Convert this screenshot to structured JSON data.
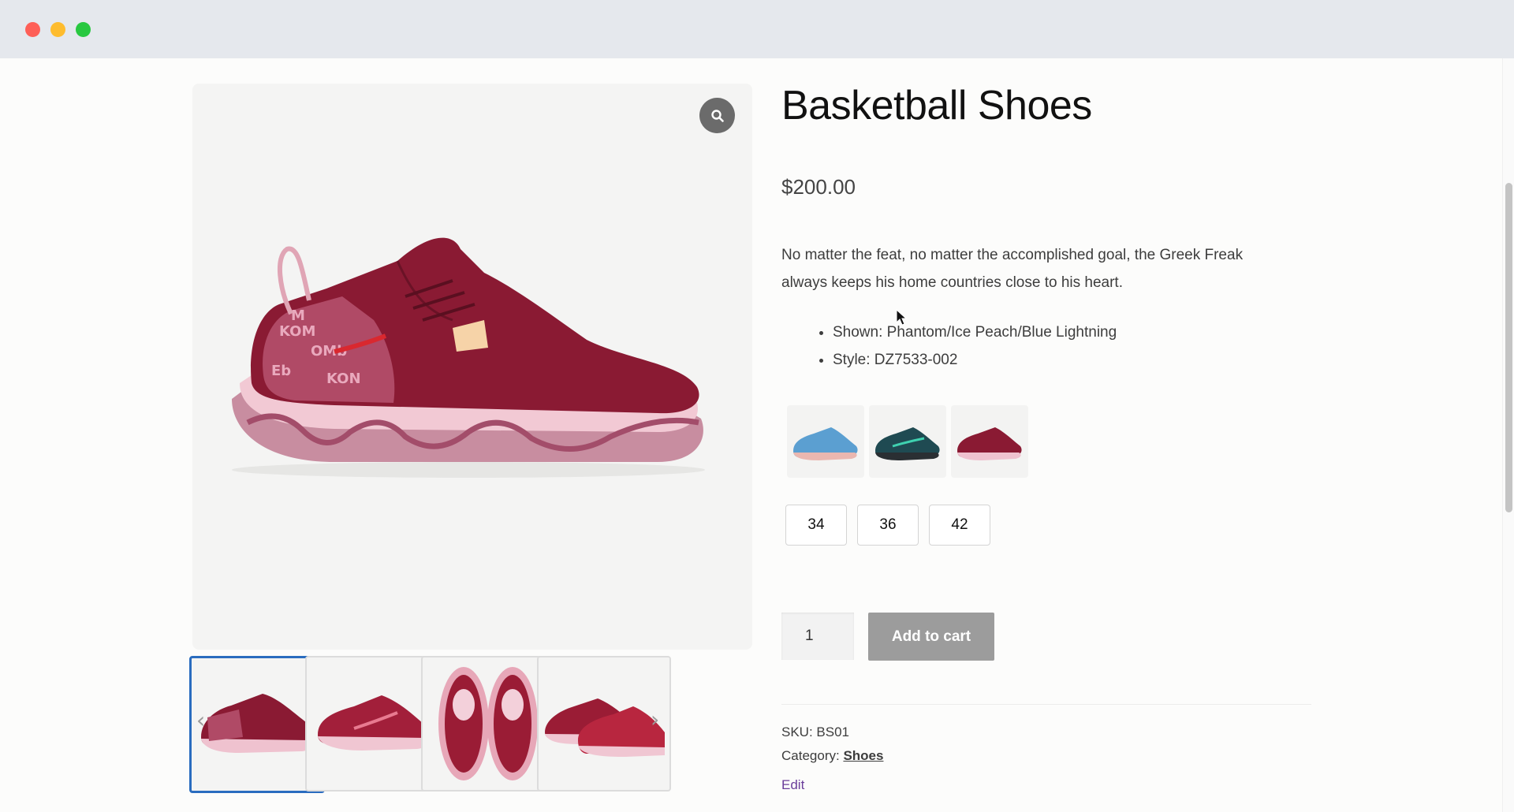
{
  "window": {
    "controls": [
      "close",
      "minimize",
      "maximize"
    ]
  },
  "product": {
    "title": "Basketball Shoes",
    "price": "$200.00",
    "description": "No matter the feat, no matter the accomplished goal, the Greek Freak always keeps his home countries close to his heart.",
    "specs": [
      "Shown: Phantom/Ice Peach/Blue Lightning",
      "Style: DZ7533-002"
    ],
    "color_swatches": [
      "blue-shoe",
      "teal-shoe",
      "red-shoe"
    ],
    "sizes": [
      "34",
      "36",
      "42"
    ],
    "quantity": "1",
    "add_to_cart_label": "Add to cart",
    "sku_label": "SKU:",
    "sku": "BS01",
    "category_label": "Category:",
    "category": "Shoes",
    "edit_label": "Edit"
  },
  "gallery": {
    "thumbnails": [
      "side-view",
      "side-view-2",
      "top-view",
      "pair-view"
    ],
    "active_thumbnail": 0
  },
  "colors": {
    "shoe_main": "#8a1a33",
    "shoe_sole": "#e8b9c4",
    "thumb_active_border": "#2a6cbf",
    "button_disabled": "#9c9c9c",
    "edit_link": "#6a3d9a"
  }
}
